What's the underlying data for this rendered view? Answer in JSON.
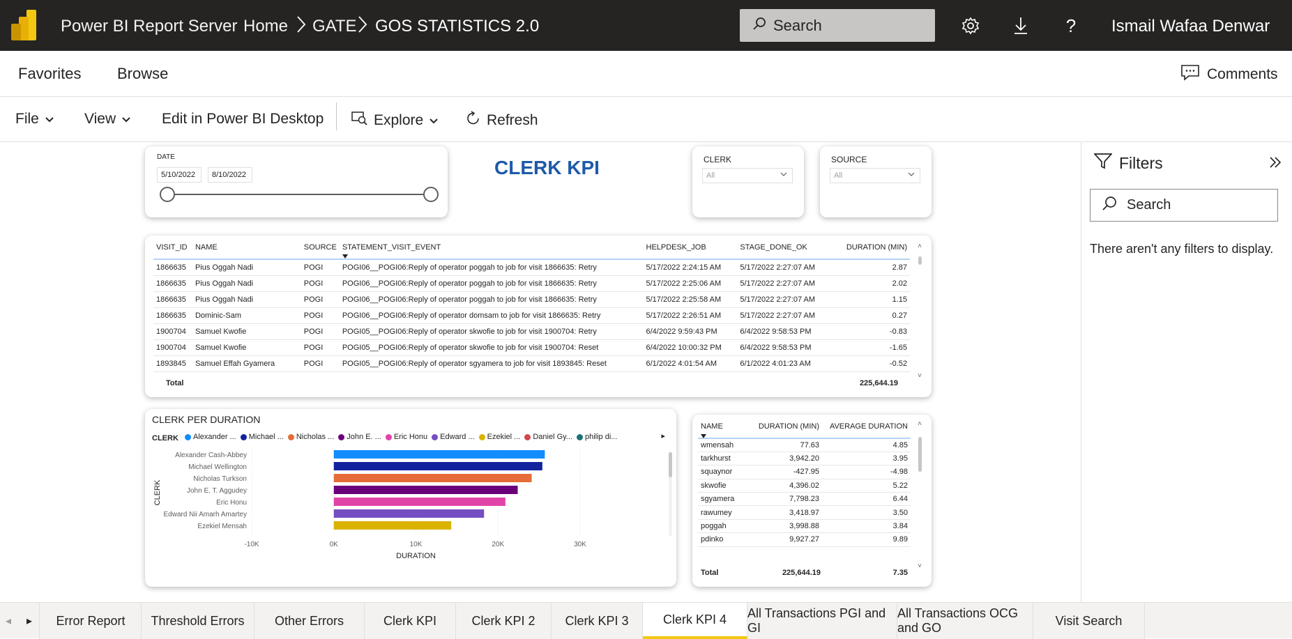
{
  "topbar": {
    "app_title": "Power BI Report Server",
    "breadcrumbs": [
      "Home",
      "GATE",
      "GOS STATISTICS 2.0"
    ],
    "search_placeholder": "Search",
    "user": "Ismail Wafaa Denwar",
    "icons": [
      "settings-icon",
      "download-icon",
      "help-icon"
    ]
  },
  "nav": {
    "favorites": "Favorites",
    "browse": "Browse",
    "comments": "Comments"
  },
  "toolbar": {
    "file": "File",
    "view": "View",
    "edit": "Edit in Power BI Desktop",
    "explore": "Explore",
    "refresh": "Refresh"
  },
  "date_slicer": {
    "label": "DATE",
    "start": "5/10/2022",
    "end": "8/10/2022"
  },
  "report_title": "CLERK KPI",
  "clerk_slicer": {
    "label": "CLERK",
    "value": "All"
  },
  "source_slicer": {
    "label": "SOURCE",
    "value": "All"
  },
  "main_table": {
    "headers": [
      "VISIT_ID",
      "NAME",
      "SOURCE",
      "STATEMENT_VISIT_EVENT",
      "HELPDESK_JOB",
      "STAGE_DONE_OK",
      "DURATION (MIN)"
    ],
    "rows": [
      [
        "1866635",
        "Pius Oggah Nadi",
        "POGI",
        "POGI06__POGI06:Reply of operator poggah to job for visit 1866635: Retry",
        "5/17/2022 2:24:15 AM",
        "5/17/2022 2:27:07 AM",
        "2.87"
      ],
      [
        "1866635",
        "Pius Oggah Nadi",
        "POGI",
        "POGI06__POGI06:Reply of operator poggah to job for visit 1866635: Retry",
        "5/17/2022 2:25:06 AM",
        "5/17/2022 2:27:07 AM",
        "2.02"
      ],
      [
        "1866635",
        "Pius Oggah Nadi",
        "POGI",
        "POGI06__POGI06:Reply of operator poggah to job for visit 1866635: Retry",
        "5/17/2022 2:25:58 AM",
        "5/17/2022 2:27:07 AM",
        "1.15"
      ],
      [
        "1866635",
        "Dominic-Sam",
        "POGI",
        "POGI06__POGI06:Reply of operator domsam to job for visit 1866635: Retry",
        "5/17/2022 2:26:51 AM",
        "5/17/2022 2:27:07 AM",
        "0.27"
      ],
      [
        "1900704",
        "Samuel Kwofie",
        "POGI",
        "POGI05__POGI06:Reply of operator skwofie to job for visit 1900704: Retry",
        "6/4/2022 9:59:43 PM",
        "6/4/2022 9:58:53 PM",
        "-0.83"
      ],
      [
        "1900704",
        "Samuel Kwofie",
        "POGI",
        "POGI05__POGI06:Reply of operator skwofie to job for visit 1900704: Reset",
        "6/4/2022 10:00:32 PM",
        "6/4/2022 9:58:53 PM",
        "-1.65"
      ],
      [
        "1893845",
        "Samuel Effah Gyamera",
        "POGI",
        "POGI05__POGI06:Reply of operator sgyamera to job for visit 1893845: Reset",
        "6/1/2022 4:01:54 AM",
        "6/1/2022 4:01:23 AM",
        "-0.52"
      ]
    ],
    "total_label": "Total",
    "total_value": "225,644.19"
  },
  "chart_data": {
    "type": "bar",
    "title": "CLERK PER DURATION",
    "legend_title": "CLERK",
    "legend": [
      {
        "name": "Alexander ...",
        "color": "#118dff"
      },
      {
        "name": "Michael ...",
        "color": "#12239e"
      },
      {
        "name": "Nicholas ...",
        "color": "#e66c37"
      },
      {
        "name": "John E. ...",
        "color": "#6b007b"
      },
      {
        "name": "Eric Honu",
        "color": "#e044a7"
      },
      {
        "name": "Edward ...",
        "color": "#744ec2"
      },
      {
        "name": "Ezekiel ...",
        "color": "#d9b300"
      },
      {
        "name": "Daniel Gy...",
        "color": "#d64550"
      },
      {
        "name": "philip di...",
        "color": "#197278"
      }
    ],
    "categories": [
      "Alexander Cash-Abbey",
      "Michael Wellington",
      "Nicholas Turkson",
      "John E. T. Aggudey",
      "Eric Honu",
      "Edward Nii Amarh Amartey",
      "Ezekiel Mensah"
    ],
    "values": [
      25700,
      25400,
      24100,
      22400,
      20900,
      18300,
      14300
    ],
    "colors": [
      "#118dff",
      "#12239e",
      "#e66c37",
      "#6b007b",
      "#e044a7",
      "#744ec2",
      "#d9b300"
    ],
    "xlim": [
      -10000,
      30000
    ],
    "xticks": [
      "-10K",
      "0K",
      "10K",
      "20K",
      "30K"
    ],
    "xlabel": "DURATION",
    "ylabel": "CLERK"
  },
  "side_table": {
    "headers": [
      "NAME",
      "DURATION (MIN)",
      "AVERAGE DURATION"
    ],
    "rows": [
      [
        "wmensah",
        "77.63",
        "4.85"
      ],
      [
        "tarkhurst",
        "3,942.20",
        "3.95"
      ],
      [
        "squaynor",
        "-427.95",
        "-4.98"
      ],
      [
        "skwofie",
        "4,396.02",
        "5.22"
      ],
      [
        "sgyamera",
        "7,798.23",
        "6.44"
      ],
      [
        "rawumey",
        "3,418.97",
        "3.50"
      ],
      [
        "poggah",
        "3,998.88",
        "3.84"
      ],
      [
        "pdinko",
        "9,927.27",
        "9.89"
      ]
    ],
    "total_label": "Total",
    "total_duration": "225,644.19",
    "total_avg": "7.35"
  },
  "filters": {
    "title": "Filters",
    "search": "Search",
    "empty": "There aren't any filters to display."
  },
  "tabs": [
    "Error Report",
    "Threshold Errors",
    "Other Errors",
    "Clerk KPI",
    "Clerk KPI 2",
    "Clerk KPI 3",
    "Clerk KPI 4",
    "All Transactions PGI and GI",
    "All Transactions OCG and GO",
    "Visit Search"
  ],
  "active_tab": "Clerk KPI 4"
}
